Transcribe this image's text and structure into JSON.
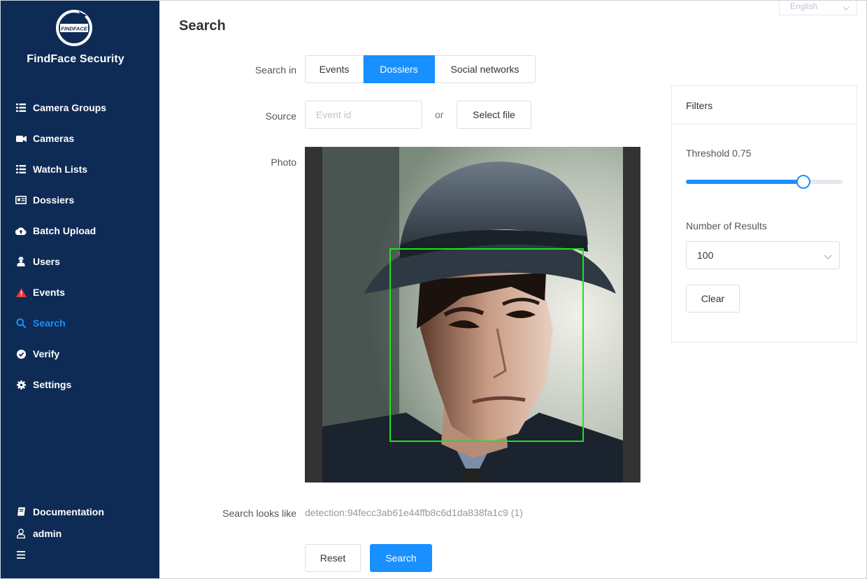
{
  "app": {
    "brand": "FindFace Security",
    "logo_text": "FINDFACE",
    "language": "English"
  },
  "sidebar": {
    "items": [
      {
        "label": "Camera Groups",
        "icon": "list-icon"
      },
      {
        "label": "Cameras",
        "icon": "video-camera-icon"
      },
      {
        "label": "Watch Lists",
        "icon": "list-icon"
      },
      {
        "label": "Dossiers",
        "icon": "id-card-icon"
      },
      {
        "label": "Batch Upload",
        "icon": "cloud-upload-icon"
      },
      {
        "label": "Users",
        "icon": "users-icon"
      },
      {
        "label": "Events",
        "icon": "warning-icon"
      },
      {
        "label": "Search",
        "icon": "search-icon",
        "active": true
      },
      {
        "label": "Verify",
        "icon": "check-circle-icon"
      },
      {
        "label": "Settings",
        "icon": "gear-icon"
      }
    ],
    "bottom": {
      "documentation": "Documentation",
      "user": "admin"
    }
  },
  "page": {
    "title": "Search"
  },
  "search_form": {
    "search_in_label": "Search in",
    "tabs": [
      {
        "label": "Events",
        "active": false
      },
      {
        "label": "Dossiers",
        "active": true
      },
      {
        "label": "Social networks",
        "active": false
      }
    ],
    "source_label": "Source",
    "event_id_placeholder": "Event id",
    "event_id_value": "",
    "or_text": "or",
    "select_file_label": "Select file",
    "photo_label": "Photo",
    "looks_like_label": "Search looks like",
    "looks_like_value": "detection:94fecc3ab61e44ffb8c6d1da838fa1c9 (1)",
    "reset_label": "Reset",
    "search_label": "Search"
  },
  "filters": {
    "title": "Filters",
    "threshold_label": "Threshold 0.75",
    "threshold_value": 0.75,
    "results_label": "Number of Results",
    "results_value": "100",
    "clear_label": "Clear"
  },
  "colors": {
    "sidebar_bg": "#0d2b55",
    "accent": "#1890ff",
    "detection_box": "#19e619",
    "events_icon": "#e53935"
  }
}
